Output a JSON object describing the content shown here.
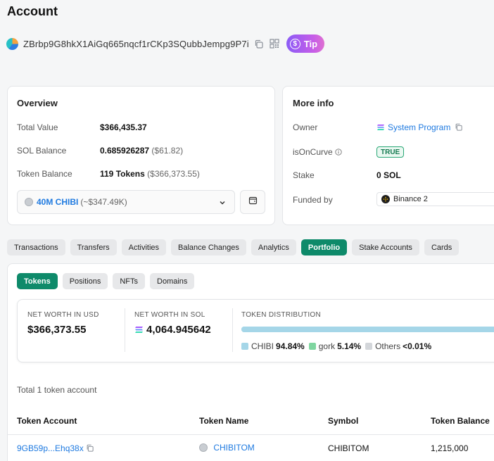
{
  "page": {
    "title": "Account"
  },
  "account": {
    "address": "ZBrbp9G8hkX1AiGq665nqcf1rCKp3SQubbJempg9P7i",
    "tip_label": "Tip",
    "tip_symbol": "$"
  },
  "overview": {
    "title": "Overview",
    "total_value_label": "Total Value",
    "total_value": "$366,435.37",
    "sol_balance_label": "SOL Balance",
    "sol_balance": "0.685926287",
    "sol_balance_usd": "($61.82)",
    "token_balance_label": "Token Balance",
    "token_balance": "119 Tokens",
    "token_balance_usd": "($366,373.55)",
    "selected_token": "40M CHIBI",
    "selected_token_usd": "(~$347.49K)"
  },
  "more_info": {
    "title": "More info",
    "owner_label": "Owner",
    "owner_value": "System Program",
    "is_on_curve_label": "isOnCurve",
    "is_on_curve_value": "TRUE",
    "stake_label": "Stake",
    "stake_value": "0 SOL",
    "funded_by_label": "Funded by",
    "funded_by_value": "Binance 2"
  },
  "tabs": [
    {
      "label": "Transactions",
      "active": false
    },
    {
      "label": "Transfers",
      "active": false
    },
    {
      "label": "Activities",
      "active": false
    },
    {
      "label": "Balance Changes",
      "active": false
    },
    {
      "label": "Analytics",
      "active": false
    },
    {
      "label": "Portfolio",
      "active": true
    },
    {
      "label": "Stake Accounts",
      "active": false
    },
    {
      "label": "Cards",
      "active": false
    }
  ],
  "portfolio": {
    "subtabs": [
      {
        "label": "Tokens",
        "active": true
      },
      {
        "label": "Positions",
        "active": false
      },
      {
        "label": "NFTs",
        "active": false
      },
      {
        "label": "Domains",
        "active": false
      }
    ],
    "net_worth_usd_label": "NET WORTH IN USD",
    "net_worth_usd": "$366,373.55",
    "net_worth_sol_label": "NET WORTH IN SOL",
    "net_worth_sol": "4,064.945642",
    "distribution_label": "TOKEN DISTRIBUTION",
    "distribution": [
      {
        "name": "CHIBI",
        "percent": "94.84%",
        "fraction": 0.9484,
        "color": "#a5d6e8"
      },
      {
        "name": "gork",
        "percent": "5.14%",
        "fraction": 0.0514,
        "color": "#7fd6a0"
      },
      {
        "name": "Others",
        "percent": "<0.01%",
        "fraction": 0.0002,
        "color": "#d3d6da"
      }
    ],
    "total_accounts": "Total 1 token account",
    "table": {
      "headers": [
        "Token Account",
        "Token Name",
        "Symbol",
        "Token Balance"
      ],
      "rows": [
        {
          "account": "9GB59p...Ehq38x",
          "name": "CHIBITOM",
          "symbol": "CHIBITOM",
          "balance": "1,215,000"
        }
      ]
    }
  },
  "colors": {
    "accent_green": "#0e8a6a",
    "link_blue": "#1f7ae0",
    "tip_gradient_start": "#8b5cf6",
    "tip_gradient_end": "#df6fd1"
  }
}
